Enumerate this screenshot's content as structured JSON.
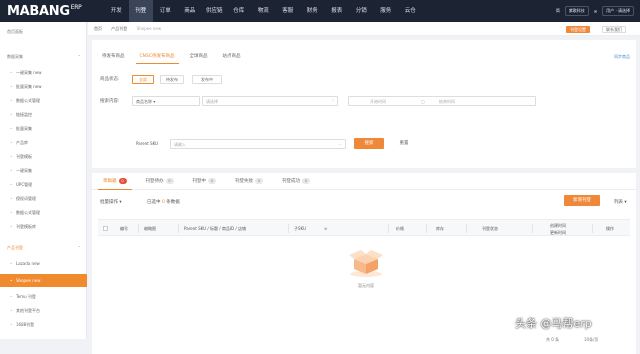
{
  "app": {
    "logo": "MABANG",
    "logo_sup": "ERP"
  },
  "topnav": [
    "开发",
    "刊登",
    "订单",
    "商品",
    "供应链",
    "仓库",
    "物流",
    "客服",
    "财务",
    "报表",
    "分销",
    "服务",
    "云仓"
  ],
  "topright": {
    "lang": "简",
    "pill1": "紫歌科技",
    "user": "用户 · 请选择"
  },
  "sidebar": [
    {
      "label": "首页面板",
      "type": "grp"
    },
    {
      "label": "数据采集",
      "type": "grp"
    },
    {
      "label": "一键采集 new",
      "type": "sub"
    },
    {
      "label": "批量采集 new",
      "type": "sub"
    },
    {
      "label": "数据公式管理",
      "type": "sub"
    },
    {
      "label": "链接监控",
      "type": "sub"
    },
    {
      "label": "批量采集",
      "type": "sub"
    },
    {
      "label": "产品库",
      "type": "sub"
    },
    {
      "label": "刊登模板",
      "type": "sub"
    },
    {
      "label": "一键采集",
      "type": "sub"
    },
    {
      "label": "UPC管理",
      "type": "sub"
    },
    {
      "label": "侵权词管理",
      "type": "sub"
    },
    {
      "label": "数据公式管理",
      "type": "sub"
    },
    {
      "label": "刊登模板库",
      "type": "sub"
    },
    {
      "label": "产品刊登",
      "type": "grp-orange"
    },
    {
      "label": "Lazada new",
      "type": "sub"
    },
    {
      "label": "Shopee new",
      "type": "sub-active"
    },
    {
      "label": "Temu 刊登",
      "type": "sub"
    },
    {
      "label": "其他刊登平台",
      "type": "sub"
    },
    {
      "label": "1688刊登",
      "type": "sub"
    }
  ],
  "crumb": {
    "home": "首页",
    "product": "产品刊登",
    "page": "Shopee new",
    "btn_o": "刊登设置",
    "btn_w": "联系我们"
  },
  "store_tabs": [
    "待发布商品",
    "CNSC待发布商品",
    "全球商品",
    "站点商品"
  ],
  "sync_link": "同步商品",
  "filter": {
    "status_label": "商品状态:",
    "status_opts": [
      "全部",
      "待发布",
      "发布中"
    ],
    "search_label": "搜索内容:",
    "search_field": "商品名称 ▾",
    "search_val": "请选择",
    "time_ph1": "开始时间",
    "time_ph2": "结束时间",
    "sku_label": "Parent SKU",
    "sku_ph": "请输入",
    "btn_search": "搜索",
    "btn_reset": "重置"
  },
  "data_tabs": [
    {
      "label": "草稿箱",
      "count": "0",
      "red": true
    },
    {
      "label": "刊登待办",
      "count": "0"
    },
    {
      "label": "刊登中",
      "count": "0"
    },
    {
      "label": "刊登失败",
      "count": "0"
    },
    {
      "label": "刊登成功",
      "count": "0"
    }
  ],
  "tools": {
    "batch": "批量操作 ▾",
    "selected": "已选中",
    "selected_count": "0",
    "unit": "条数据",
    "add": "新增刊登",
    "cols": "列表 ▾"
  },
  "table": {
    "cols": [
      "编号",
      "缩略图",
      "Parent SKU / 标题 / 商品ID / 店铺",
      "子SKU",
      "价格",
      "库存",
      "刊登状态",
      "创建时间",
      "操作"
    ],
    "col_extra": "更新时间"
  },
  "empty": "暂无内容",
  "pager": {
    "total": "共 0 条",
    "size": "10条/页"
  },
  "watermark": "头条 @马帮erp"
}
